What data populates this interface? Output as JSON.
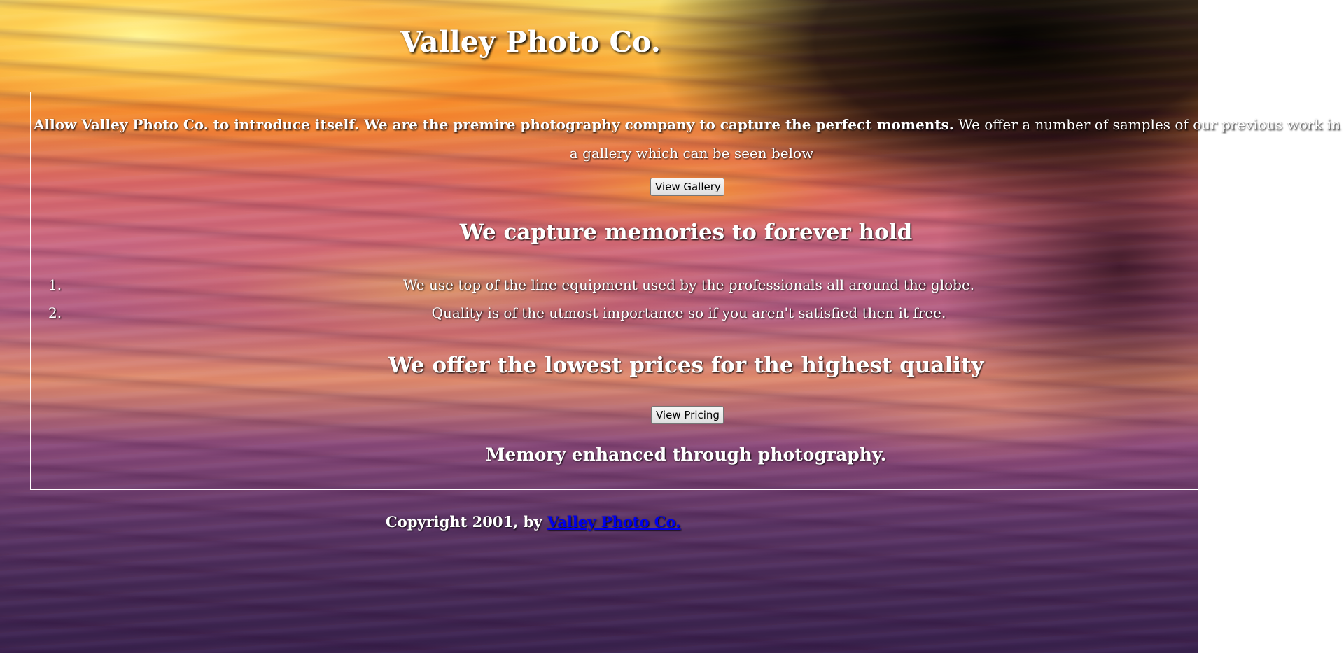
{
  "page": {
    "brand_title": "Valley Photo Co."
  },
  "intro": {
    "bold_text": "Allow Valley Photo Co. to introduce itself. We are the premire photography company to capture the perfect moments.",
    "normal_text_line1": " We offer a number of samples of our previous work in",
    "normal_text_line2": "a gallery which can be seen below"
  },
  "buttons": {
    "gallery_label": "View Gallery",
    "pricing_label": "View Pricing"
  },
  "sections": {
    "capture_heading": "We capture memories to forever hold",
    "features": [
      {
        "number": "1.",
        "text": "We use top of the line equipment used by the professionals all around the globe."
      },
      {
        "number": "2.",
        "text": "Quality is of the utmost importance so if you aren't satisfied then it free."
      }
    ],
    "prices_heading": "We offer the lowest prices for the highest quality",
    "tagline": "Memory enhanced through photography."
  },
  "footer": {
    "copyright_text": "Copyright 2001, by ",
    "link_text": "Valley Photo Co."
  },
  "colors": {
    "text": "#ffffff",
    "link": "#0000ee",
    "panel_border": "#ffffff"
  }
}
